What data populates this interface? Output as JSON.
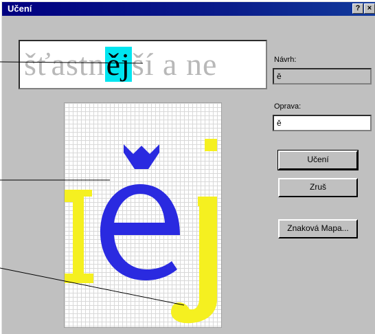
{
  "window": {
    "title": "Učení",
    "help_glyph": "?",
    "close_glyph": "×"
  },
  "preview": {
    "before": "šťastn",
    "highlight": "ěj",
    "after": "ší  a  ne"
  },
  "fields": {
    "navrh_label": "Návrh:",
    "navrh_value": "ě",
    "oprava_label": "Oprava:",
    "oprava_value": "ě"
  },
  "buttons": {
    "uceni": "Učení",
    "zrus": "Zruš",
    "mapa": "Znaková Mapa..."
  },
  "glyph_grid": {
    "main_char": "ě",
    "main_color": "#2a2ae0",
    "neighbor_color": "#f5f020"
  }
}
